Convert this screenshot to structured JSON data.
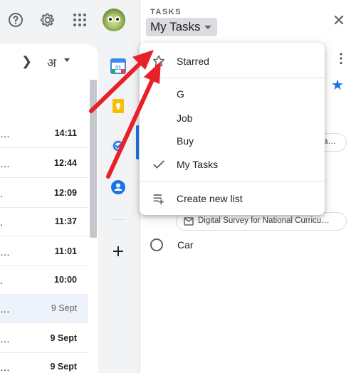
{
  "header": {
    "help_icon": "help-circle-icon",
    "settings_icon": "gear-icon",
    "apps_icon": "apps-grid-icon",
    "avatar_icon": "account-avatar"
  },
  "mail": {
    "toolbar": {
      "next_icon": "chevron-right-icon",
      "language_label": "अ"
    },
    "rows": [
      {
        "snippet": "…",
        "time": "14:11"
      },
      {
        "snippet": "…",
        "time": "12:44"
      },
      {
        "snippet": ".",
        "time": "12:09"
      },
      {
        "snippet": ".",
        "time": "11:37"
      },
      {
        "snippet": "…",
        "time": "11:01"
      },
      {
        "snippet": ".",
        "time": "10:00"
      },
      {
        "snippet": "…",
        "time": "9 Sept"
      },
      {
        "snippet": "…",
        "time": "9 Sept"
      },
      {
        "snippet": "…",
        "time": "9 Sept"
      }
    ]
  },
  "side_apps": [
    "calendar-icon",
    "keep-icon",
    "tasks-icon",
    "contacts-icon",
    "add-icon"
  ],
  "tasks": {
    "section_label": "TASKS",
    "current_list": "My Tasks",
    "chip_partial": "a…",
    "chip_email": "Digital Survey for National Curricu…",
    "task_title": "Car"
  },
  "menu": {
    "starred": "Starred",
    "lists": [
      {
        "label": "G",
        "checked": false
      },
      {
        "label": "Job",
        "checked": false
      },
      {
        "label": "Buy",
        "checked": false
      },
      {
        "label": "My Tasks",
        "checked": true
      }
    ],
    "create_new": "Create new list"
  },
  "colors": {
    "accent": "#1a73e8",
    "annotation_arrow": "#e8202a"
  }
}
